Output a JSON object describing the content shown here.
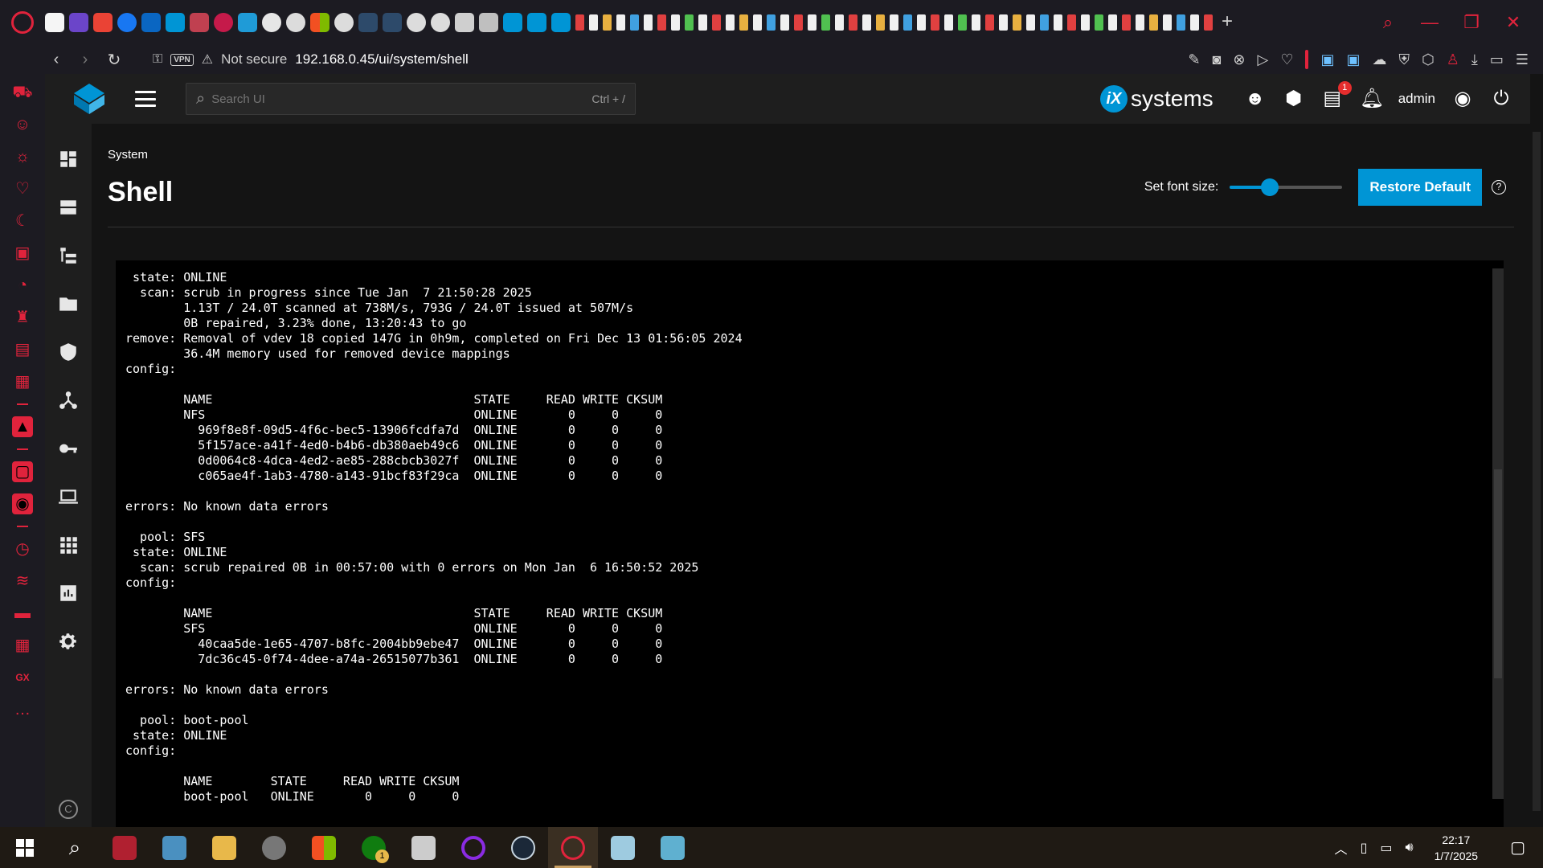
{
  "browser": {
    "address": {
      "security_label": "Not secure",
      "url": "192.168.0.45/ui/system/shell",
      "vpn_label": "VPN"
    },
    "window_controls": {
      "minimize": "—",
      "restore": "❐",
      "close": "✕"
    }
  },
  "header": {
    "search": {
      "placeholder": "Search UI",
      "shortcut": "Ctrl + /"
    },
    "brand": {
      "mark": "iX",
      "text": "systems"
    },
    "jobs_badge": "1",
    "user": "admin"
  },
  "page": {
    "breadcrumb": "System",
    "title": "Shell",
    "font_size_label": "Set font size:",
    "font_size_fraction": 0.33,
    "restore_label": "Restore Default",
    "help_glyph": "?"
  },
  "terminal": {
    "lines": [
      " state: ONLINE",
      "  scan: scrub in progress since Tue Jan  7 21:50:28 2025",
      "        1.13T / 24.0T scanned at 738M/s, 793G / 24.0T issued at 507M/s",
      "        0B repaired, 3.23% done, 13:20:43 to go",
      "remove: Removal of vdev 18 copied 147G in 0h9m, completed on Fri Dec 13 01:56:05 2024",
      "        36.4M memory used for removed device mappings",
      "config:",
      "",
      "        NAME                                    STATE     READ WRITE CKSUM",
      "        NFS                                     ONLINE       0     0     0",
      "          969f8e8f-09d5-4f6c-bec5-13906fcdfa7d  ONLINE       0     0     0",
      "          5f157ace-a41f-4ed0-b4b6-db380aeb49c6  ONLINE       0     0     0",
      "          0d0064c8-4dca-4ed2-ae85-288cbcb3027f  ONLINE       0     0     0",
      "          c065ae4f-1ab3-4780-a143-91bcf83f29ca  ONLINE       0     0     0",
      "",
      "errors: No known data errors",
      "",
      "  pool: SFS",
      " state: ONLINE",
      "  scan: scrub repaired 0B in 00:57:00 with 0 errors on Mon Jan  6 16:50:52 2025",
      "config:",
      "",
      "        NAME                                    STATE     READ WRITE CKSUM",
      "        SFS                                     ONLINE       0     0     0",
      "          40caa5de-1e65-4707-b8fc-2004bb9ebe47  ONLINE       0     0     0",
      "          7dc36c45-0f74-4dee-a74a-26515077b361  ONLINE       0     0     0",
      "",
      "errors: No known data errors",
      "",
      "  pool: boot-pool",
      " state: ONLINE",
      "config:",
      "",
      "        NAME        STATE     READ WRITE CKSUM",
      "        boot-pool   ONLINE       0     0     0"
    ]
  },
  "taskbar": {
    "time": "22:17",
    "date": "1/7/2025",
    "xbox_badge": "1"
  },
  "colors": {
    "accent": "#0095d5",
    "opera_red": "#e0233c",
    "terminal_bg": "#000000"
  }
}
